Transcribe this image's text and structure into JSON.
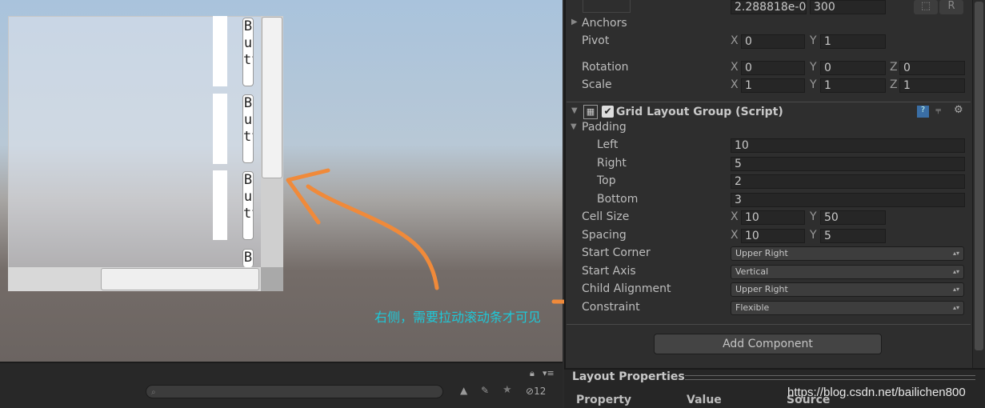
{
  "scene": {
    "button_text": "Butt",
    "last_button_text": "B"
  },
  "annotation": {
    "text": "右侧，需要拉动滚动条才可见",
    "color": "#1ec8d8",
    "stroke": "#f08a3a"
  },
  "bottom": {
    "hidden_count": "12",
    "search_placeholder": ""
  },
  "inspector": {
    "top_fields": [
      "2.288818e-0",
      "300"
    ],
    "anchors": "Anchors",
    "pivot": {
      "label": "Pivot",
      "x": "0",
      "y": "1"
    },
    "rotation": {
      "label": "Rotation",
      "x": "0",
      "y": "0",
      "z": "0"
    },
    "scale": {
      "label": "Scale",
      "x": "1",
      "y": "1",
      "z": "1"
    },
    "component_title": "Grid Layout Group (Script)",
    "padding": {
      "label": "Padding",
      "left_label": "Left",
      "left": "10",
      "right_label": "Right",
      "right": "5",
      "top_label": "Top",
      "top": "2",
      "bottom_label": "Bottom",
      "bottom": "3"
    },
    "cell_size": {
      "label": "Cell Size",
      "x": "10",
      "y": "50"
    },
    "spacing": {
      "label": "Spacing",
      "x": "10",
      "y": "5"
    },
    "start_corner": {
      "label": "Start Corner",
      "value": "Upper Right"
    },
    "start_axis": {
      "label": "Start Axis",
      "value": "Vertical"
    },
    "child_alignment": {
      "label": "Child Alignment",
      "value": "Upper Right"
    },
    "constraint": {
      "label": "Constraint",
      "value": "Flexible"
    },
    "add_component": "Add Component",
    "layout_properties": "Layout Properties",
    "columns": [
      "Property",
      "Value",
      "Source"
    ],
    "axis": {
      "x": "X",
      "y": "Y",
      "z": "Z"
    }
  },
  "watermark": "https://blog.csdn.net/bailichen800"
}
